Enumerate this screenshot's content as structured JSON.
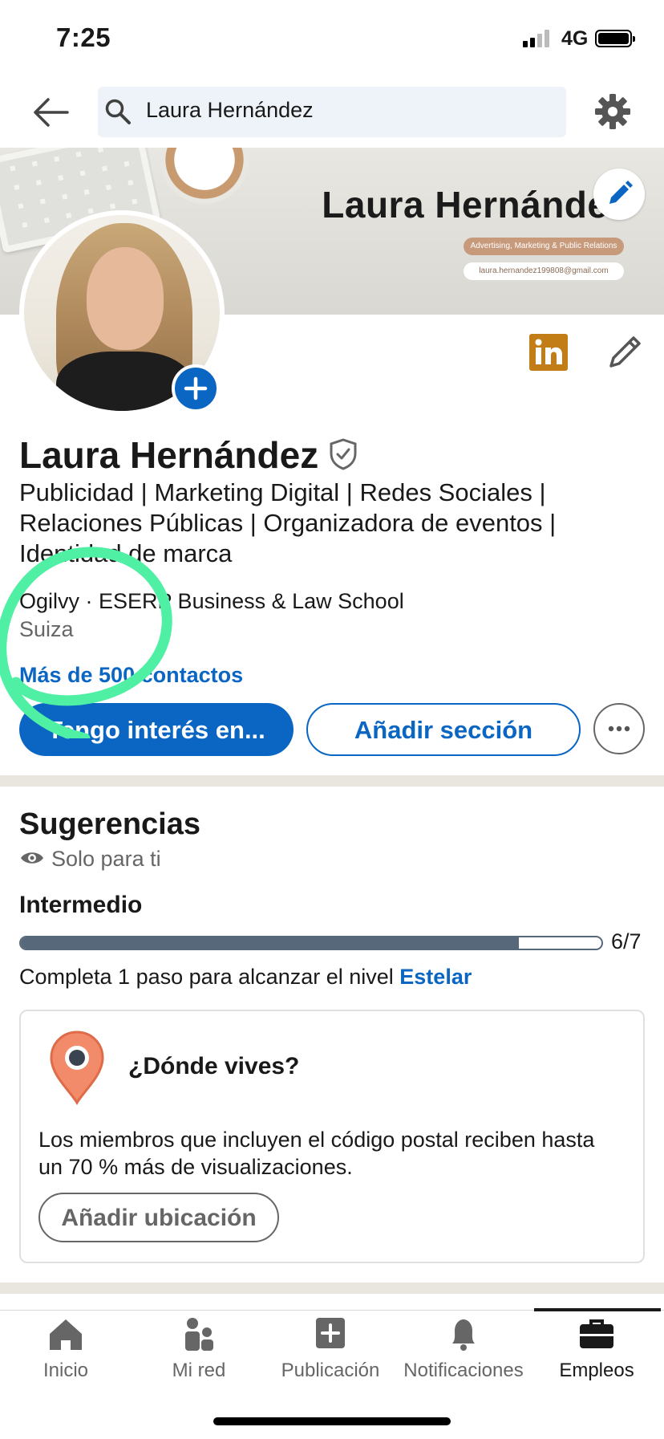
{
  "status_bar": {
    "time": "7:25",
    "network": "4G"
  },
  "header": {
    "search_value": "Laura Hernández"
  },
  "banner": {
    "name": "Laura Hernández",
    "tagline": "Advertising, Marketing & Public Relations",
    "email": "laura.hernandez199808@gmail.com"
  },
  "profile": {
    "name": "Laura Hernández",
    "headline": "Publicidad | Marketing Digital | Redes Sociales | Relaciones Públicas | Organizadora de eventos | Identidad de marca",
    "company": "Ogilvy · ESERP Business & Law School",
    "location": "Suiza",
    "connections": "Más de 500 contactos",
    "open_to_label": "Tengo interés en...",
    "add_section_label": "Añadir sección"
  },
  "suggestions": {
    "title": "Sugerencias",
    "privacy": "Solo para ti",
    "level": "Intermedio",
    "progress": {
      "current": 6,
      "total": 7,
      "label": "6/7"
    },
    "complete_text": "Completa 1 paso para alcanzar el nivel ",
    "next_level": "Estelar",
    "card": {
      "title": "¿Dónde vives?",
      "body": "Los miembros que incluyen el código postal reciben hasta un 70 % más de visualizaciones.",
      "button": "Añadir ubicación"
    }
  },
  "bottom_nav": [
    {
      "label": "Inicio",
      "icon": "home-icon"
    },
    {
      "label": "Mi red",
      "icon": "network-icon"
    },
    {
      "label": "Publicación",
      "icon": "post-icon"
    },
    {
      "label": "Notificaciones",
      "icon": "bell-icon"
    },
    {
      "label": "Empleos",
      "icon": "briefcase-icon",
      "active": true
    }
  ],
  "colors": {
    "accent": "#0a66c2",
    "annotation": "#4ff0a4",
    "linkedin_badge": "#c37d16",
    "pin": "#f28b6a"
  }
}
